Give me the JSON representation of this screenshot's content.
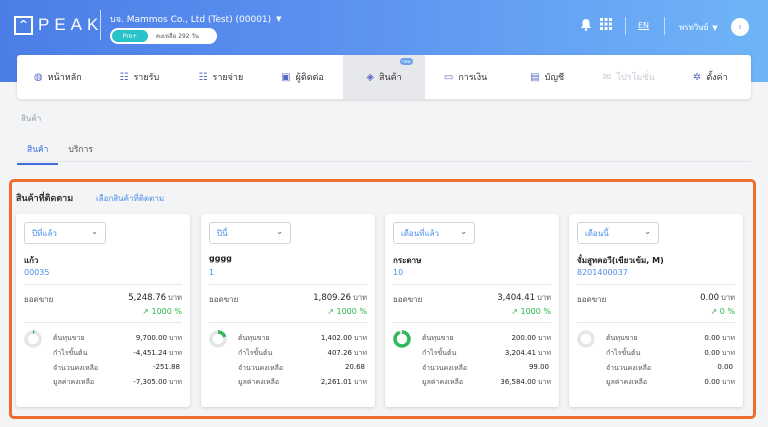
{
  "header": {
    "logo_letter": "^",
    "logo_text": "PEAK",
    "company": "บจ. Mammos Co., Ltd (Test) (00001)",
    "plan": "Pro+",
    "days_left": "คงเหลือ 292 วัน",
    "lang": "EN",
    "user": "พรทวิษย์",
    "avatar_initial": "ı",
    "bg_gradient": [
      "#4c7ee6",
      "#6fb4f7"
    ]
  },
  "nav": {
    "items": [
      {
        "label": "หน้าหลัก",
        "icon": "dashboard-icon"
      },
      {
        "label": "รายรับ",
        "icon": "income-icon"
      },
      {
        "label": "รายจ่าย",
        "icon": "expense-icon"
      },
      {
        "label": "ผู้ติดต่อ",
        "icon": "contact-icon"
      },
      {
        "label": "สินค้า",
        "icon": "box-icon",
        "badge": "new"
      },
      {
        "label": "การเงิน",
        "icon": "money-icon"
      },
      {
        "label": "บัญชี",
        "icon": "book-icon"
      },
      {
        "label": "โปรโมชั่น",
        "icon": "promo-icon"
      },
      {
        "label": "ตั้งค่า",
        "icon": "gear-icon"
      }
    ]
  },
  "breadcrumb": "สินค้า",
  "tabs": [
    "สินค้า",
    "บริการ"
  ],
  "tracked": {
    "title": "สินค้าที่ติดตาม",
    "select_link": "เลือกสินค้าที่ติดตาม",
    "border_color": "#ef6c2f",
    "stat_labels": [
      "ต้นทุนขาย",
      "กำไรขั้นต้น",
      "จำนวนคงเหลือ",
      "มูลค่าคงเหลือ"
    ],
    "sales_label": "ยอดขาย",
    "unit": "บาท",
    "cards": [
      {
        "period": "ปีที่แล้ว",
        "name": "แก้ว",
        "code": "00035",
        "sales": "5,248.76",
        "growth": "1000 %",
        "stats": [
          "9,700.00",
          "-4,451.24",
          "-251.88",
          "-7,305.00"
        ],
        "stat_units": [
          "บาท",
          "บาท",
          "",
          "บาท"
        ],
        "donut_ratio": 0.03
      },
      {
        "period": "ปีนี้",
        "name": "gggg",
        "code": "1",
        "sales": "1,809.26",
        "growth": "1000 %",
        "stats": [
          "1,402.00",
          "407.26",
          "20.68",
          "2,261.01"
        ],
        "stat_units": [
          "บาท",
          "บาท",
          "",
          "บาท"
        ],
        "donut_ratio": 0.2
      },
      {
        "period": "เดือนที่แล้ว",
        "name": "กระดาษ",
        "code": "10",
        "sales": "3,404.41",
        "growth": "1000 %",
        "stats": [
          "200.00",
          "3,204.41",
          "99.00",
          "36,584.00"
        ],
        "stat_units": [
          "บาท",
          "บาท",
          "",
          "บาท"
        ],
        "donut_ratio": 0.94
      },
      {
        "period": "เดือนนี้",
        "name": "จั๋มสูทคอวี(เขียวเข้ม, M)",
        "code": "8201400037",
        "sales": "0.00",
        "growth": "0 %",
        "stats": [
          "0.00",
          "0.00",
          "0.00",
          "0.00"
        ],
        "stat_units": [
          "บาท",
          "บาท",
          "",
          "บาท"
        ],
        "donut_ratio": 0
      }
    ]
  }
}
